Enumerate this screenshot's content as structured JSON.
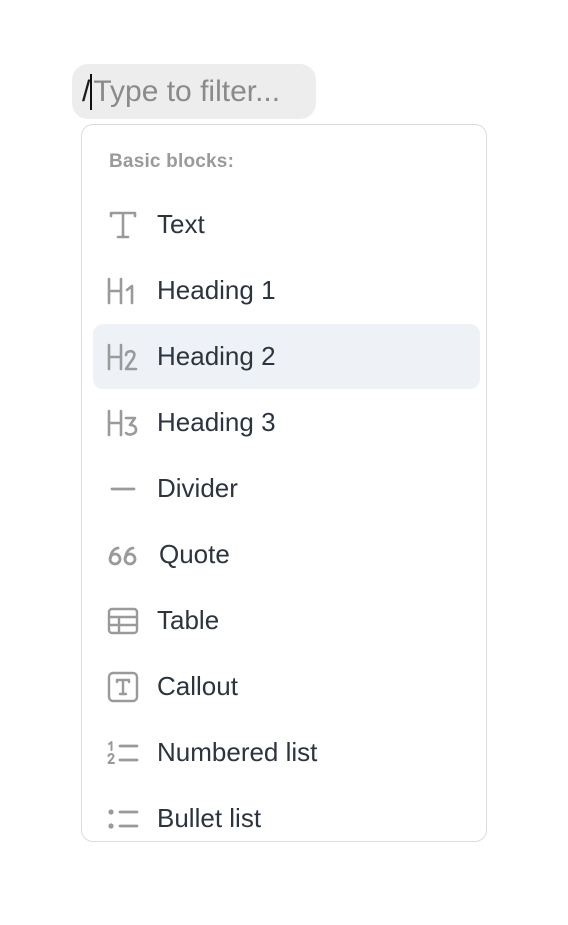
{
  "filter": {
    "slash": "/",
    "placeholder": "Type to filter..."
  },
  "menu": {
    "section_title": "Basic blocks:",
    "selected_index": 2,
    "items": [
      {
        "label": "Text",
        "icon": "text-icon"
      },
      {
        "label": "Heading 1",
        "icon": "heading-1-icon"
      },
      {
        "label": "Heading 2",
        "icon": "heading-2-icon"
      },
      {
        "label": "Heading 3",
        "icon": "heading-3-icon"
      },
      {
        "label": "Divider",
        "icon": "divider-icon"
      },
      {
        "label": "Quote",
        "icon": "quote-icon"
      },
      {
        "label": "Table",
        "icon": "table-icon"
      },
      {
        "label": "Callout",
        "icon": "callout-icon"
      },
      {
        "label": "Numbered list",
        "icon": "numbered-list-icon"
      },
      {
        "label": "Bullet list",
        "icon": "bullet-list-icon"
      }
    ]
  },
  "colors": {
    "icon": "#9a9a9a",
    "label": "#2c3440",
    "selected_bg": "#eef2f7"
  }
}
